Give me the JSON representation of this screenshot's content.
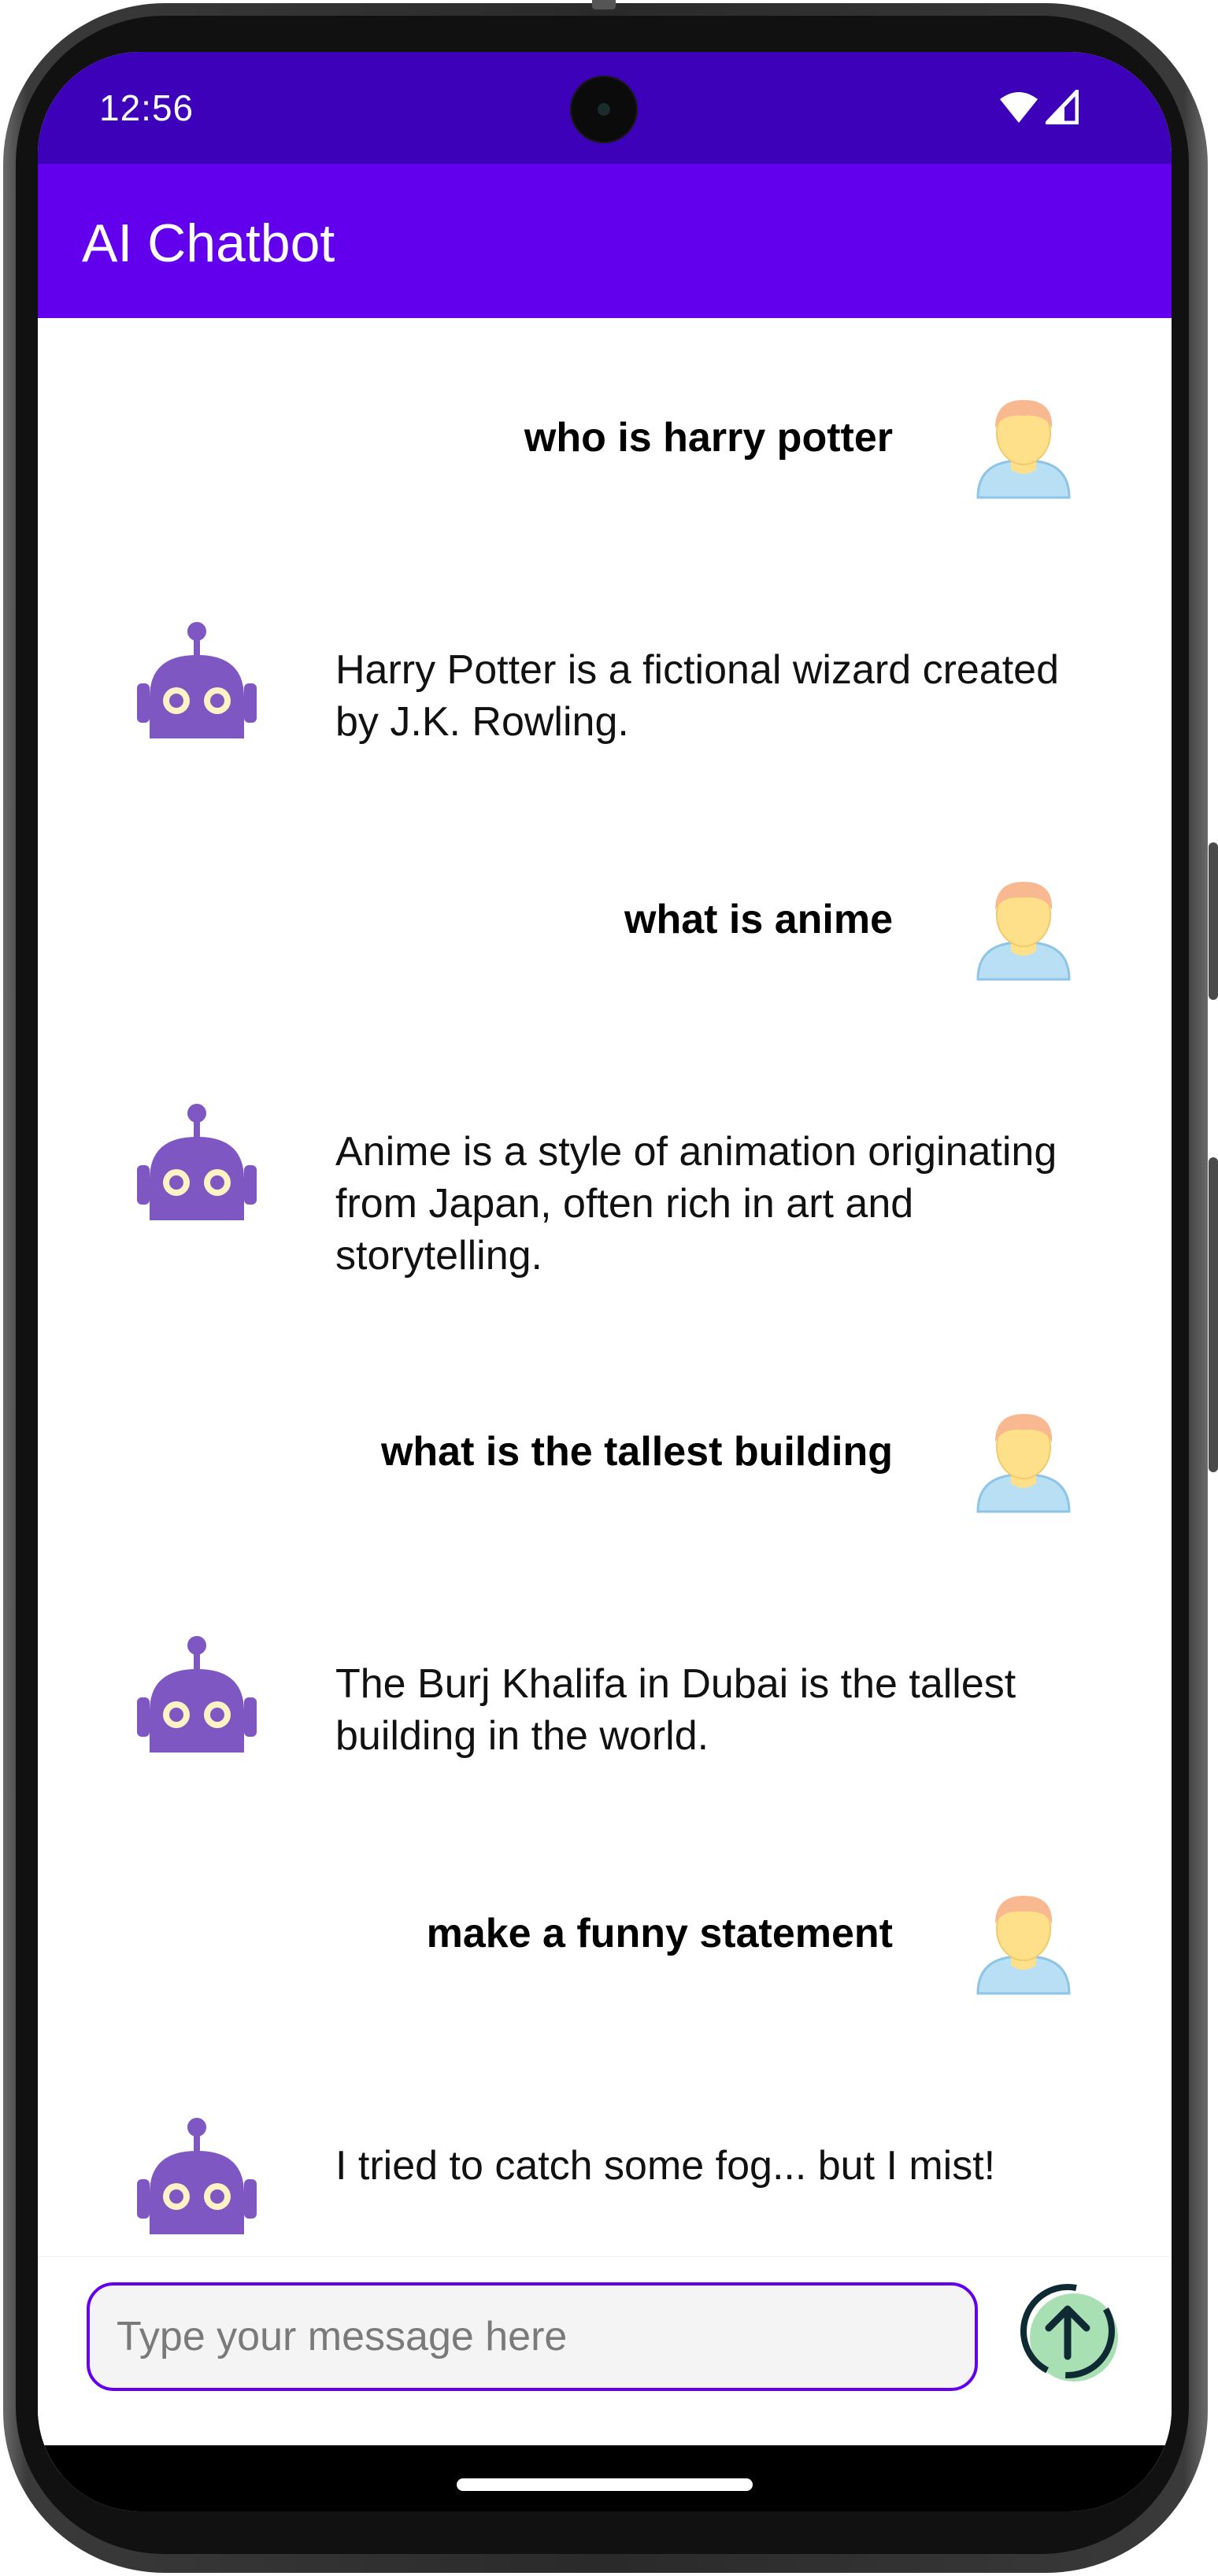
{
  "status_bar": {
    "time": "12:56",
    "icons": [
      "wifi-icon",
      "signal-icon"
    ]
  },
  "app_bar": {
    "title": "AI Chatbot",
    "background": "#6200ee"
  },
  "colors": {
    "status_bar": "#3d01ba",
    "primary": "#6200ee",
    "bot_avatar": "#7e57c2",
    "send_button": "#a8e0b4"
  },
  "messages": [
    {
      "role": "user",
      "text": "who is harry potter"
    },
    {
      "role": "bot",
      "text": "Harry Potter is a fictional wizard created by J.K. Rowling."
    },
    {
      "role": "user",
      "text": "what is anime"
    },
    {
      "role": "bot",
      "text": "Anime is a style of animation originating from Japan, often rich in art and storytelling."
    },
    {
      "role": "user",
      "text": "what is the tallest building"
    },
    {
      "role": "bot",
      "text": "The Burj Khalifa in Dubai is the tallest building in the world."
    },
    {
      "role": "user",
      "text": "make a funny statement"
    },
    {
      "role": "bot",
      "text": "I tried to catch some fog... but I mist!"
    }
  ],
  "input": {
    "placeholder": "Type your message here",
    "value": ""
  },
  "send_button": {
    "icon": "arrow-up-icon"
  }
}
